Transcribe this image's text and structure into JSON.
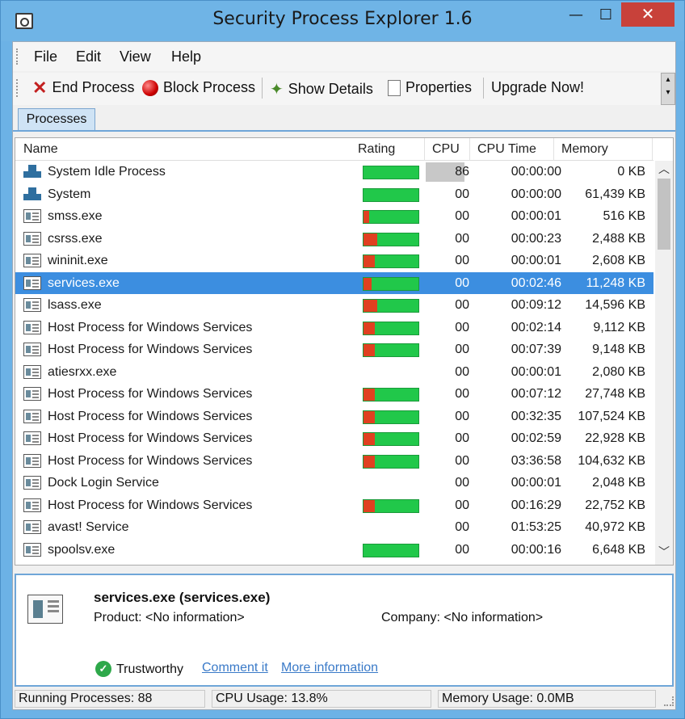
{
  "window": {
    "title": "Security Process Explorer 1.6",
    "minimize": "—",
    "maximize": "☐",
    "close": "✕"
  },
  "menu": [
    "File",
    "Edit",
    "View",
    "Help"
  ],
  "toolbar": {
    "end_process": "End Process",
    "block_process": "Block Process",
    "show_details": "Show Details",
    "properties": "Properties",
    "upgrade": "Upgrade Now!"
  },
  "tab": {
    "label": "Processes"
  },
  "columns": {
    "name": "Name",
    "rating": "Rating",
    "cpu": "CPU",
    "cpu_time": "CPU Time",
    "memory": "Memory"
  },
  "processes": [
    {
      "name": "System Idle Process",
      "cpu": "86",
      "cpu_time": "00:00:00",
      "memory": "0 KB",
      "red": 0,
      "rating": true,
      "icon": "system",
      "cpu_highlight": true
    },
    {
      "name": "System",
      "cpu": "00",
      "cpu_time": "00:00:00",
      "memory": "61,439 KB",
      "red": 0,
      "rating": true,
      "icon": "system"
    },
    {
      "name": "smss.exe",
      "cpu": "00",
      "cpu_time": "00:00:01",
      "memory": "516 KB",
      "red": 0.1,
      "rating": true,
      "icon": "app"
    },
    {
      "name": "csrss.exe",
      "cpu": "00",
      "cpu_time": "00:00:23",
      "memory": "2,488 KB",
      "red": 0.25,
      "rating": true,
      "icon": "app"
    },
    {
      "name": "wininit.exe",
      "cpu": "00",
      "cpu_time": "00:00:01",
      "memory": "2,608 KB",
      "red": 0.2,
      "rating": true,
      "icon": "app"
    },
    {
      "name": "services.exe",
      "cpu": "00",
      "cpu_time": "00:02:46",
      "memory": "11,248 KB",
      "red": 0.15,
      "rating": true,
      "icon": "app",
      "selected": true
    },
    {
      "name": "lsass.exe",
      "cpu": "00",
      "cpu_time": "00:09:12",
      "memory": "14,596 KB",
      "red": 0.25,
      "rating": true,
      "icon": "app"
    },
    {
      "name": "Host Process for Windows Services",
      "cpu": "00",
      "cpu_time": "00:02:14",
      "memory": "9,112 KB",
      "red": 0.2,
      "rating": true,
      "icon": "app"
    },
    {
      "name": "Host Process for Windows Services",
      "cpu": "00",
      "cpu_time": "00:07:39",
      "memory": "9,148 KB",
      "red": 0.2,
      "rating": true,
      "icon": "app"
    },
    {
      "name": "atiesrxx.exe",
      "cpu": "00",
      "cpu_time": "00:00:01",
      "memory": "2,080 KB",
      "red": 0,
      "rating": false,
      "icon": "app"
    },
    {
      "name": "Host Process for Windows Services",
      "cpu": "00",
      "cpu_time": "00:07:12",
      "memory": "27,748 KB",
      "red": 0.2,
      "rating": true,
      "icon": "app"
    },
    {
      "name": "Host Process for Windows Services",
      "cpu": "00",
      "cpu_time": "00:32:35",
      "memory": "107,524 KB",
      "red": 0.2,
      "rating": true,
      "icon": "app"
    },
    {
      "name": "Host Process for Windows Services",
      "cpu": "00",
      "cpu_time": "00:02:59",
      "memory": "22,928 KB",
      "red": 0.2,
      "rating": true,
      "icon": "app"
    },
    {
      "name": "Host Process for Windows Services",
      "cpu": "00",
      "cpu_time": "03:36:58",
      "memory": "104,632 KB",
      "red": 0.2,
      "rating": true,
      "icon": "app"
    },
    {
      "name": "Dock Login Service",
      "cpu": "00",
      "cpu_time": "00:00:01",
      "memory": "2,048 KB",
      "red": 0,
      "rating": false,
      "icon": "app"
    },
    {
      "name": "Host Process for Windows Services",
      "cpu": "00",
      "cpu_time": "00:16:29",
      "memory": "22,752 KB",
      "red": 0.2,
      "rating": true,
      "icon": "app"
    },
    {
      "name": "avast! Service",
      "cpu": "00",
      "cpu_time": "01:53:25",
      "memory": "40,972 KB",
      "red": 0,
      "rating": false,
      "icon": "app"
    },
    {
      "name": "spoolsv.exe",
      "cpu": "00",
      "cpu_time": "00:00:16",
      "memory": "6,648 KB",
      "red": 0,
      "rating": true,
      "icon": "app"
    }
  ],
  "details": {
    "title": "services.exe (services.exe)",
    "product": "Product: <No information>",
    "company": "Company: <No information>",
    "trust": "Trustworthy",
    "comment_link": "Comment it",
    "more_link": "More information"
  },
  "status": {
    "running": "Running Processes: 88",
    "cpu": "CPU Usage: 13.8%",
    "memory": "Memory Usage: 0.0MB"
  },
  "colors": {
    "selected_row": "#3c8ee0",
    "rating_good": "#21c84a",
    "rating_bad": "#e04020"
  }
}
